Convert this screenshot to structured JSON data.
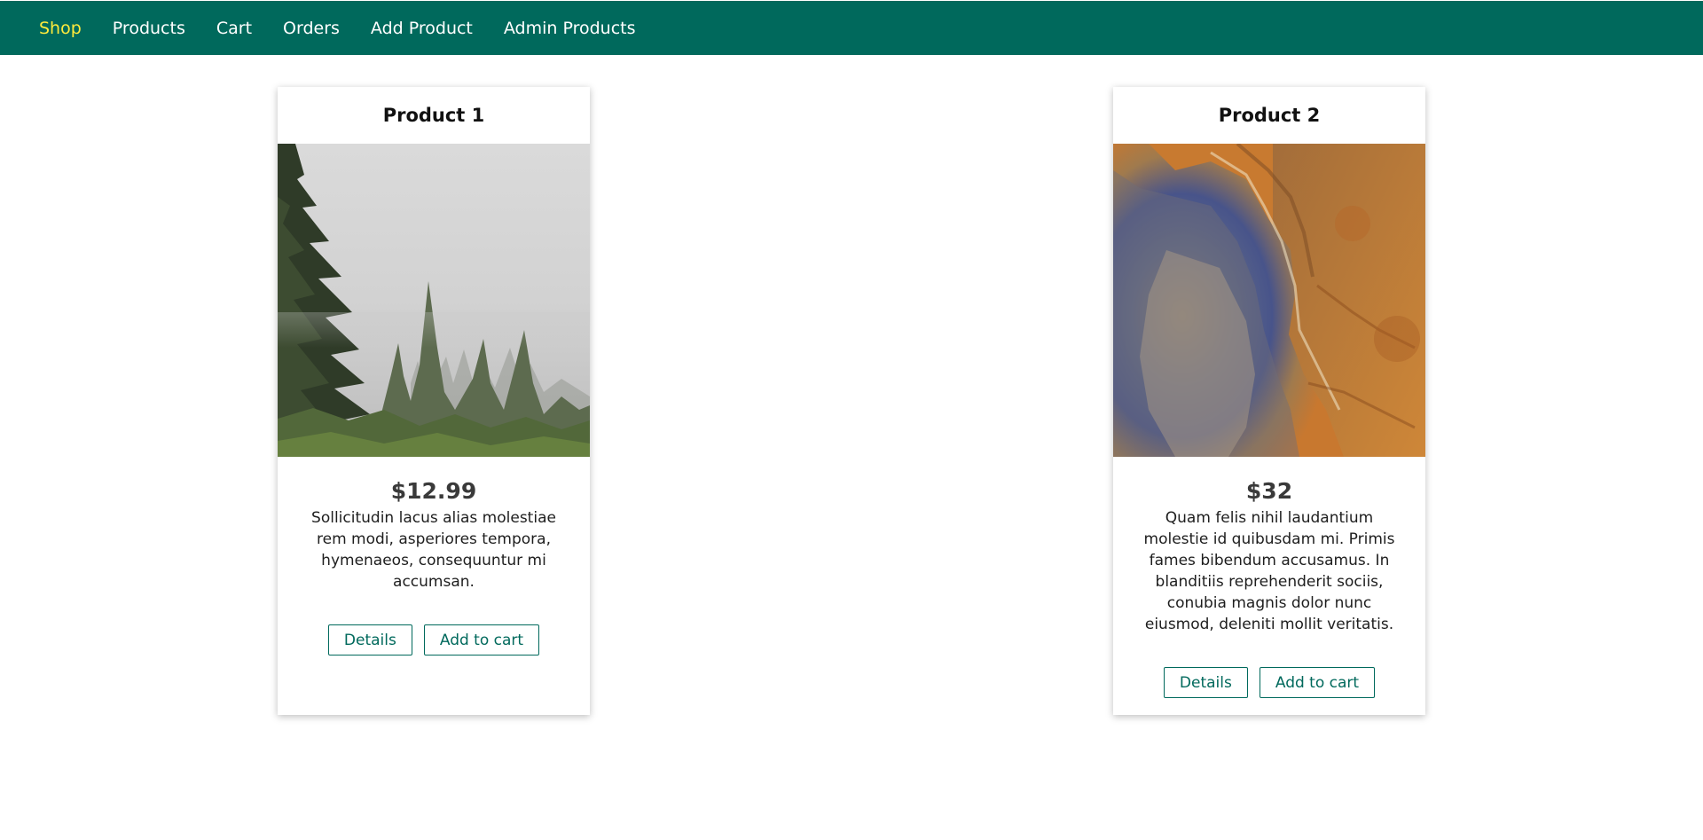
{
  "nav": {
    "items": [
      {
        "label": "Shop",
        "active": true
      },
      {
        "label": "Products",
        "active": false
      },
      {
        "label": "Cart",
        "active": false
      },
      {
        "label": "Orders",
        "active": false
      },
      {
        "label": "Add Product",
        "active": false
      },
      {
        "label": "Admin Products",
        "active": false
      }
    ],
    "active_color": "#ffeb3b",
    "bar_color": "#00695c"
  },
  "products": [
    {
      "title": "Product 1",
      "image": "misty-forest-image",
      "price": "$12.99",
      "description": "Sollicitudin lacus alias molestiae rem modi, asperiores tempora, hymenaeos, consequuntur mi accumsan.",
      "details_label": "Details",
      "add_to_cart_label": "Add to cart"
    },
    {
      "title": "Product 2",
      "image": "mars-crater-image",
      "price": "$32",
      "description": "Quam felis nihil laudantium molestie id quibusdam mi. Primis fames bibendum accusamus. In blanditiis reprehenderit sociis, conubia magnis dolor nunc eiusmod, deleniti mollit veritatis.",
      "details_label": "Details",
      "add_to_cart_label": "Add to cart"
    }
  ]
}
